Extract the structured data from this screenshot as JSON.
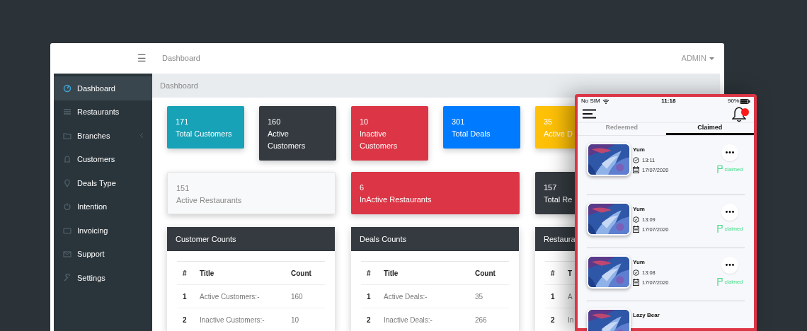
{
  "topbar": {
    "menu_icon": "☰",
    "title": "Dashboard",
    "user": "ADMIN"
  },
  "sidebar": {
    "items": [
      {
        "label": "Dashboard",
        "selected": true,
        "expandable": false
      },
      {
        "label": "Restaurants",
        "selected": false,
        "expandable": false
      },
      {
        "label": "Branches",
        "selected": false,
        "expandable": true
      },
      {
        "label": "Customers",
        "selected": false,
        "expandable": false
      },
      {
        "label": "Deals Type",
        "selected": false,
        "expandable": false
      },
      {
        "label": "Intention",
        "selected": false,
        "expandable": false
      },
      {
        "label": "Invoicing",
        "selected": false,
        "expandable": false
      },
      {
        "label": "Support",
        "selected": false,
        "expandable": false
      },
      {
        "label": "Settings",
        "selected": false,
        "expandable": false
      }
    ]
  },
  "breadcrumb": "Dashboard",
  "stat_cards": [
    {
      "value": "171",
      "label": "Total Customers",
      "color": "#17a2b8"
    },
    {
      "value": "160",
      "label": "Active Customers",
      "color": "#343a40"
    },
    {
      "value": "10",
      "label": "Inactive Customers",
      "color": "#dc3545"
    },
    {
      "value": "301",
      "label": "Total Deals",
      "color": "#007bff"
    },
    {
      "value": "35",
      "label": "Active D",
      "color": "#ffc107"
    }
  ],
  "wide_cards": [
    {
      "value": "151",
      "label": "Active Restaurants",
      "color": "#f8f9fa"
    },
    {
      "value": "6",
      "label": "InActive Restaurants",
      "color": "#dc3545"
    },
    {
      "value": "157",
      "label": "Total Re",
      "color": "#343a40"
    }
  ],
  "tables": [
    {
      "title": "Customer Counts",
      "columns": [
        "#",
        "Title",
        "Count"
      ],
      "rows": [
        [
          "1",
          "Active Customers:-",
          "160"
        ],
        [
          "2",
          "Inactive Customers:-",
          "10"
        ]
      ]
    },
    {
      "title": "Deals Counts",
      "columns": [
        "#",
        "Title",
        "Count"
      ],
      "rows": [
        [
          "1",
          "Active Deals:-",
          "35"
        ],
        [
          "2",
          "Inactive Deals:-",
          "266"
        ]
      ]
    },
    {
      "title": "Restaura",
      "columns": [
        "#",
        "T"
      ],
      "rows": [
        [
          "1",
          "A"
        ],
        [
          "2",
          "In"
        ]
      ]
    }
  ],
  "phone": {
    "status_bar": {
      "carrier": "No SIM",
      "time": "11:18",
      "battery": "90%"
    },
    "tabs": [
      {
        "label": "Redeemed",
        "selected": false
      },
      {
        "label": "Claimed",
        "selected": true
      }
    ],
    "deals": [
      {
        "name": "Yum",
        "time": "13:11",
        "date": "17/07/2020",
        "status": "claimed"
      },
      {
        "name": "Yum",
        "time": "13:09",
        "date": "17/07/2020",
        "status": "claimed"
      },
      {
        "name": "Yum",
        "time": "13:08",
        "date": "17/07/2020",
        "status": "claimed"
      },
      {
        "name": "Lazy Bear"
      }
    ]
  }
}
